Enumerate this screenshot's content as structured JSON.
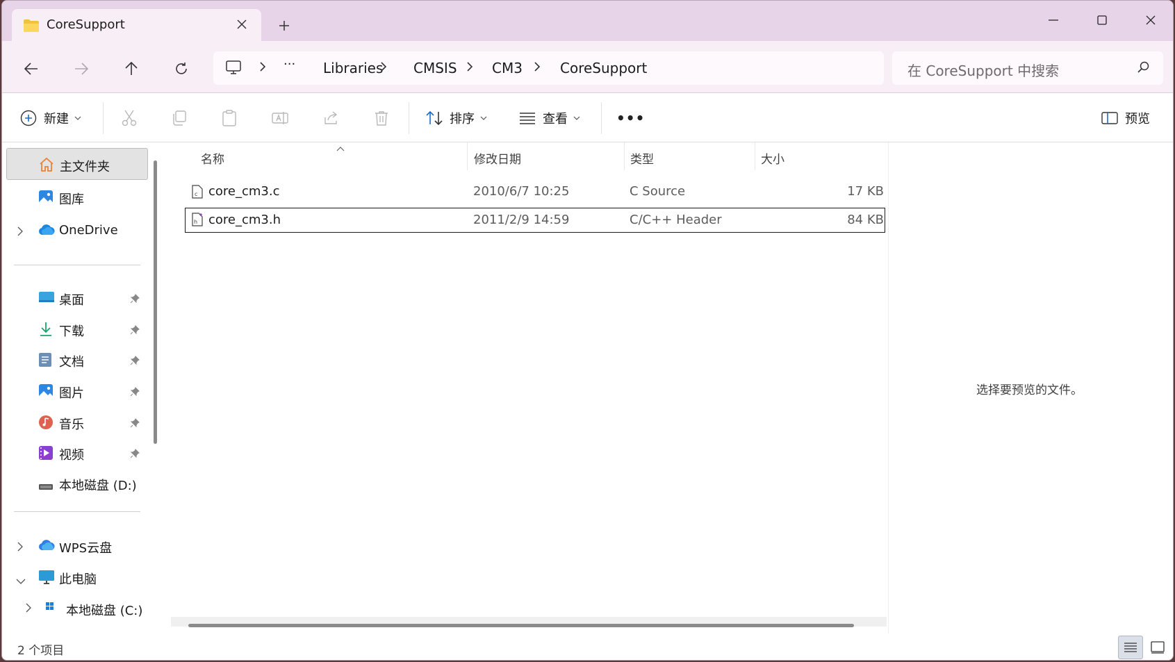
{
  "window": {
    "tab_title": "CoreSupport",
    "new_tab_symbol": "+",
    "controls": [
      "minimize",
      "maximize",
      "close"
    ]
  },
  "nav": {
    "breadcrumb": [
      "Libraries",
      "CMSIS",
      "CM3",
      "CoreSupport"
    ],
    "overflow": "···",
    "search_placeholder": "在 CoreSupport 中搜索"
  },
  "toolbar": {
    "new_label": "新建",
    "sort_label": "排序",
    "view_label": "查看",
    "more_label": "•••",
    "preview_label": "预览"
  },
  "sidebar": {
    "home": "主文件夹",
    "gallery": "图库",
    "onedrive": "OneDrive",
    "quick": [
      {
        "label": "桌面",
        "icon": "desktop-icon"
      },
      {
        "label": "下载",
        "icon": "download-icon"
      },
      {
        "label": "文档",
        "icon": "document-icon"
      },
      {
        "label": "图片",
        "icon": "pictures-icon"
      },
      {
        "label": "音乐",
        "icon": "music-icon"
      },
      {
        "label": "视频",
        "icon": "video-icon"
      },
      {
        "label": "本地磁盘 (D:)",
        "icon": "drive-icon"
      }
    ],
    "wps": "WPS云盘",
    "this_pc": "此电脑",
    "local_c": "本地磁盘 (C:)"
  },
  "list": {
    "headers": {
      "name": "名称",
      "date": "修改日期",
      "type": "类型",
      "size": "大小"
    },
    "rows": [
      {
        "name": "core_cm3.c",
        "date": "2010/6/7 10:25",
        "type": "C Source",
        "size": "17 KB"
      },
      {
        "name": "core_cm3.h",
        "date": "2011/2/9 14:59",
        "type": "C/C++ Header",
        "size": "84 KB"
      }
    ]
  },
  "preview": {
    "message": "选择要预览的文件。"
  },
  "status": {
    "item_count": "2 个项目"
  }
}
